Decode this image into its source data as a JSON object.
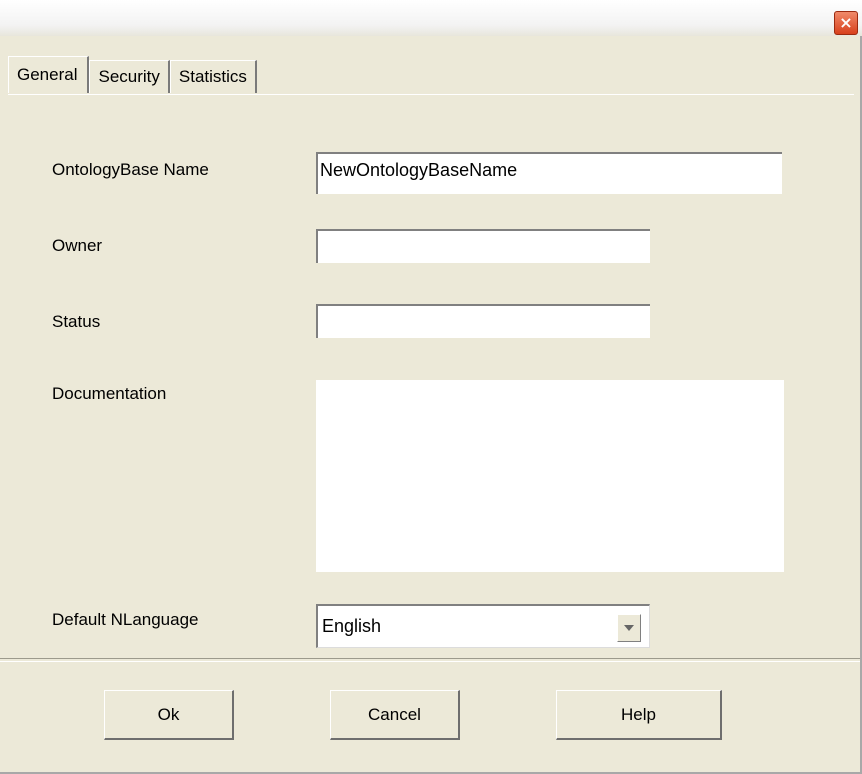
{
  "window": {
    "close_symbol": "×"
  },
  "tabs": [
    {
      "label": "General",
      "active": true
    },
    {
      "label": "Security",
      "active": false
    },
    {
      "label": "Statistics",
      "active": false
    }
  ],
  "form": {
    "name_label": "OntologyBase Name",
    "name_value": "NewOntologyBaseName",
    "owner_label": "Owner",
    "owner_value": "",
    "status_label": "Status",
    "status_value": "",
    "documentation_label": "Documentation",
    "documentation_value": "",
    "language_label": "Default NLanguage",
    "language_value": "English"
  },
  "buttons": {
    "ok": "Ok",
    "cancel": "Cancel",
    "help": "Help"
  },
  "icons": {
    "close": "close-icon",
    "dropdown": "chevron-down-icon"
  },
  "colors": {
    "dialog_bg": "#ece9d8",
    "close_button": "#d8401c"
  }
}
